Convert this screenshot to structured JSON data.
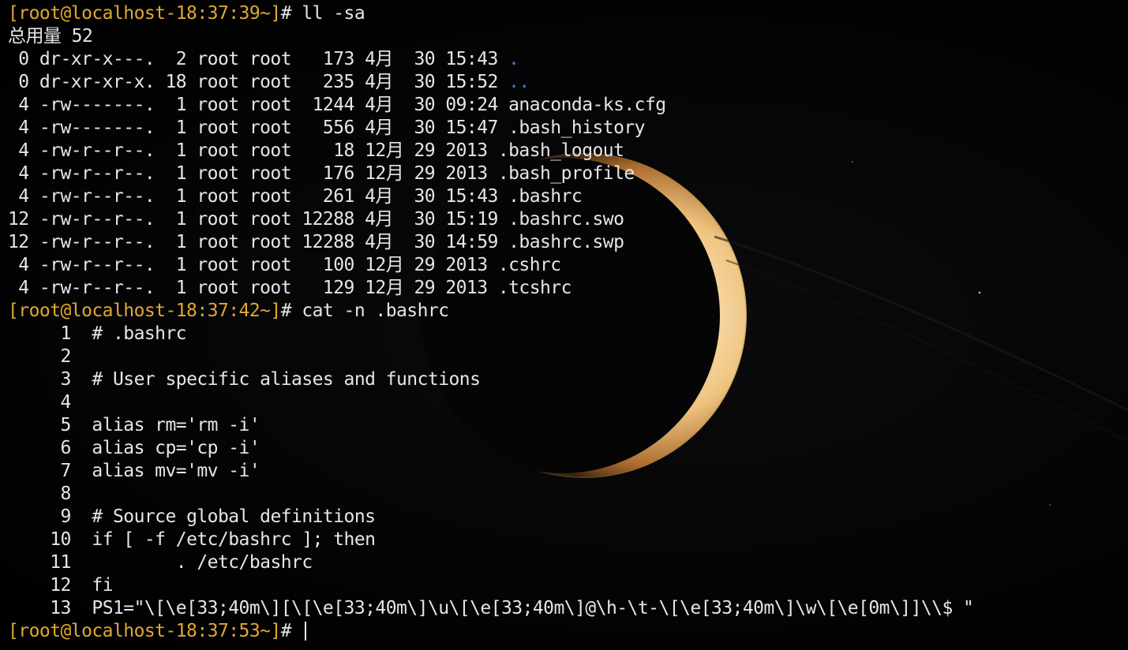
{
  "terminal": {
    "prompt_color": "#e0a832",
    "dir_color": "#3f7fe0",
    "text_color": "#e6e6e6",
    "background": "#000000",
    "wallpaper": "crescent-planet",
    "lines": [
      {
        "kind": "prompt",
        "prompt": "[root@localhost-18:37:39~]",
        "text": "# ll -sa"
      },
      {
        "kind": "output",
        "text": "总用量 52"
      },
      {
        "kind": "dir",
        "text": " 0 dr-xr-x---.  2 root root   173 4月  30 15:43 ",
        "name": "."
      },
      {
        "kind": "dir",
        "text": " 0 dr-xr-xr-x. 18 root root   235 4月  30 15:52 ",
        "name": ".."
      },
      {
        "kind": "output",
        "text": " 4 -rw-------.  1 root root  1244 4月  30 09:24 anaconda-ks.cfg"
      },
      {
        "kind": "output",
        "text": " 4 -rw-------.  1 root root   556 4月  30 15:47 .bash_history"
      },
      {
        "kind": "output",
        "text": " 4 -rw-r--r--.  1 root root    18 12月 29 2013 .bash_logout"
      },
      {
        "kind": "output",
        "text": " 4 -rw-r--r--.  1 root root   176 12月 29 2013 .bash_profile"
      },
      {
        "kind": "output",
        "text": " 4 -rw-r--r--.  1 root root   261 4月  30 15:43 .bashrc"
      },
      {
        "kind": "output",
        "text": "12 -rw-r--r--.  1 root root 12288 4月  30 15:19 .bashrc.swo"
      },
      {
        "kind": "output",
        "text": "12 -rw-r--r--.  1 root root 12288 4月  30 14:59 .bashrc.swp"
      },
      {
        "kind": "output",
        "text": " 4 -rw-r--r--.  1 root root   100 12月 29 2013 .cshrc"
      },
      {
        "kind": "output",
        "text": " 4 -rw-r--r--.  1 root root   129 12月 29 2013 .tcshrc"
      },
      {
        "kind": "prompt",
        "prompt": "[root@localhost-18:37:42~]",
        "text": "# cat -n .bashrc"
      },
      {
        "kind": "output",
        "text": "     1\t# .bashrc"
      },
      {
        "kind": "output",
        "text": "     2"
      },
      {
        "kind": "output",
        "text": "     3\t# User specific aliases and functions"
      },
      {
        "kind": "output",
        "text": "     4"
      },
      {
        "kind": "output",
        "text": "     5\talias rm='rm -i'"
      },
      {
        "kind": "output",
        "text": "     6\talias cp='cp -i'"
      },
      {
        "kind": "output",
        "text": "     7\talias mv='mv -i'"
      },
      {
        "kind": "output",
        "text": "     8"
      },
      {
        "kind": "output",
        "text": "     9\t# Source global definitions"
      },
      {
        "kind": "output",
        "text": "    10\tif [ -f /etc/bashrc ]; then"
      },
      {
        "kind": "output",
        "text": "    11\t\t. /etc/bashrc"
      },
      {
        "kind": "output",
        "text": "    12\tfi"
      },
      {
        "kind": "output",
        "text": "    13\tPS1=\"\\[\\e[33;40m\\][\\[\\e[33;40m\\]\\u\\[\\e[33;40m\\]@\\h-\\t-\\[\\e[33;40m\\]\\w\\[\\e[0m\\]]\\\\$ \""
      },
      {
        "kind": "input",
        "prompt": "[root@localhost-18:37:53~]",
        "text": "# "
      }
    ]
  }
}
